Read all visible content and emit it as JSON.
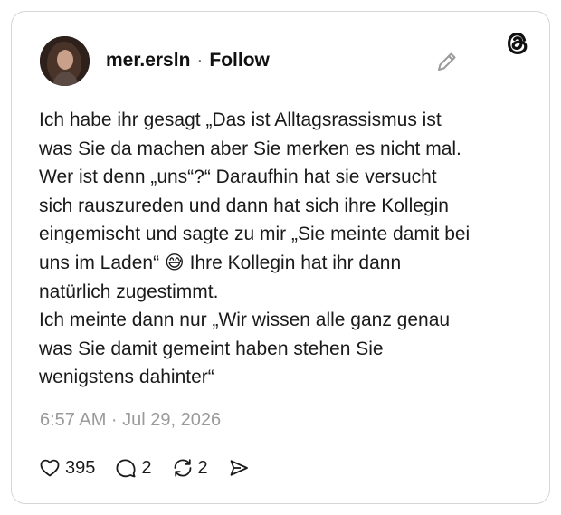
{
  "post": {
    "author": {
      "username": "mer.ersln",
      "separator": "·",
      "follow_label": "Follow"
    },
    "body_lines": [
      "Ich habe ihr gesagt „Das ist Alltagsrassismus ist",
      "was Sie da machen aber Sie merken es nicht mal.",
      "Wer ist denn „uns“?“ Daraufhin hat sie versucht",
      "sich rauszureden und dann hat sich ihre Kollegin",
      "eingemischt und sagte zu mir „Sie meinte damit bei",
      "uns im Laden“ 😅 Ihre Kollegin hat ihr dann",
      "natürlich zugestimmt.",
      "Ich meinte dann nur „Wir wissen alle ganz genau",
      "was Sie damit gemeint haben stehen Sie",
      "wenigstens dahinter“"
    ],
    "timestamp": "6:57 AM · Jul 29, 2026",
    "stats": {
      "likes": "395",
      "replies": "2",
      "reposts": "2"
    }
  },
  "icons": {
    "brand": "threads-logo-icon",
    "edit": "pencil-icon",
    "like": "heart-icon",
    "reply": "comment-icon",
    "repost": "repost-icon",
    "share": "send-icon"
  },
  "colors": {
    "text": "#1a1a1a",
    "muted": "#9a9a9a",
    "border": "#d6d6d6",
    "background": "#ffffff"
  }
}
